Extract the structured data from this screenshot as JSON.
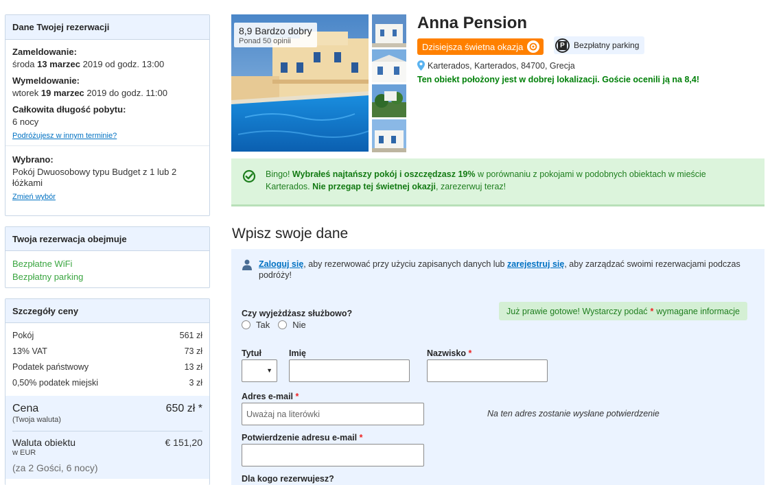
{
  "booking": {
    "header": "Dane Twojej rezerwacji",
    "checkin_label": "Zameldowanie:",
    "checkin_day": "środa ",
    "checkin_date": "13 marzec",
    "checkin_rest": " 2019 od godz. 13:00",
    "checkout_label": "Wymeldowanie:",
    "checkout_day": "wtorek ",
    "checkout_date": "19 marzec",
    "checkout_rest": " 2019 do godz. 11:00",
    "length_label": "Całkowita długość pobytu:",
    "length_value": "6 nocy",
    "other_dates_link": "Podróżujesz w innym terminie?",
    "selected_label": "Wybrano:",
    "selected_value": "Pokój Dwuosobowy typu Budget z 1 lub 2 łóżkami",
    "change_link": "Zmień wybór"
  },
  "includes": {
    "header": "Twoja rezerwacja obejmuje",
    "items": [
      "Bezpłatne WiFi",
      "Bezpłatny parking"
    ]
  },
  "price": {
    "header": "Szczegóły ceny",
    "rows": [
      {
        "label": "Pokój",
        "value": "561 zł"
      },
      {
        "label": "13% VAT",
        "value": "73 zł"
      },
      {
        "label": "Podatek państwowy",
        "value": "13 zł"
      },
      {
        "label": "0,50% podatek miejski",
        "value": "3 zł"
      }
    ],
    "total_label": "Cena",
    "total_value": "650 zł *",
    "total_note": "(Twoja waluta)",
    "currency_label": "Waluta obiektu",
    "currency_value": "€ 151,20",
    "currency_note": "w EUR",
    "guests": "(za 2 Gości, 6 nocy)"
  },
  "hotel": {
    "name": "Anna Pension",
    "score": "8,9 Bardzo dobry",
    "reviews": "Ponad 50 opinii",
    "deal_badge": "Dzisiejsza świetna okazja",
    "parking_badge": "Bezpłatny parking",
    "address": "Karterados, Karterados, 84700, Grecja",
    "location_msg": "Ten obiekt położony jest w dobrej lokalizacji. Goście ocenili ją na 8,4!"
  },
  "bingo": {
    "p1": "Bingo! ",
    "b1": "Wybrałeś najtańszy pokój i oszczędzasz 19%",
    "p2": " w porównaniu z pokojami w podobnych obiektach w mieście Karterados. ",
    "b2": "Nie przegap tej świetnej okazji",
    "p3": ", zarezerwuj teraz!"
  },
  "form": {
    "title": "Wpisz swoje dane",
    "login_link": "Zaloguj się",
    "login_mid": ", aby rezerwować przy użyciu zapisanych danych lub ",
    "register_link": "zarejestruj się",
    "login_end": ", aby zarządzać swoimi rezerwacjami podczas podróży!",
    "ready_text": "Już prawie gotowe! Wystarczy podać",
    "ready_star": "*",
    "ready_end": "wymagane informacje",
    "business_q": "Czy wyjeżdżasz służbowo?",
    "opt_yes": "Tak",
    "opt_no": "Nie",
    "title_label": "Tytuł",
    "firstname_label": "Imię",
    "lastname_label": "Nazwisko",
    "req_star": "*",
    "email_label": "Adres e-mail",
    "email_placeholder": "Uważaj na literówki",
    "email_hint": "Na ten adres zostanie wysłane potwierdzenie",
    "email_confirm_label": "Potwierdzenie adresu e-mail",
    "for_whom_label": "Dla kogo rezerwujesz?"
  },
  "colors": {
    "accent_blue": "#0071c2",
    "deal_orange": "#ff8000",
    "success_green": "#008009",
    "panel_blue": "#ebf3ff"
  }
}
